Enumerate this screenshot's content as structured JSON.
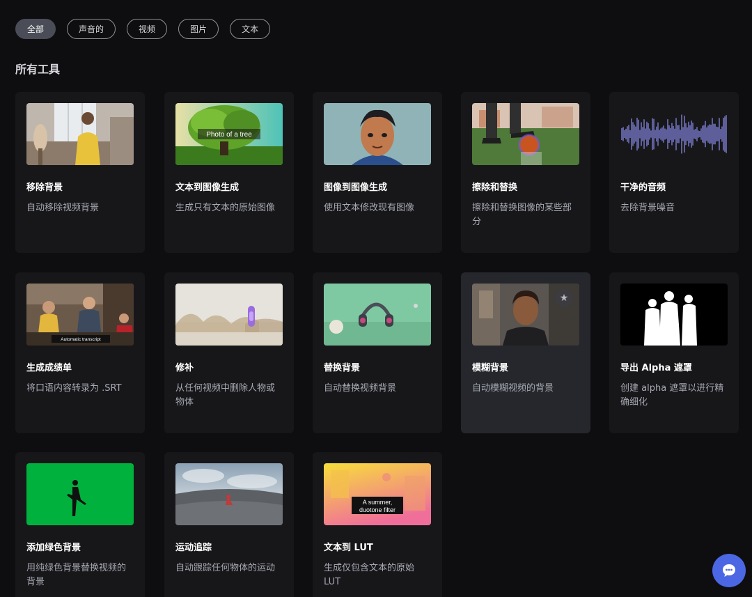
{
  "filters": [
    "全部",
    "声音的",
    "视频",
    "图片",
    "文本"
  ],
  "section_title": "所有工具",
  "cards": [
    {
      "title": "移除背景",
      "desc": "自动移除视频背景"
    },
    {
      "title": "文本到图像生成",
      "desc": "生成只有文本的原始图像",
      "overlay": "Photo of a tree"
    },
    {
      "title": "图像到图像生成",
      "desc": "使用文本修改现有图像"
    },
    {
      "title": "擦除和替换",
      "desc": "擦除和替换图像的某些部分"
    },
    {
      "title": "干净的音频",
      "desc": "去除背景噪音"
    },
    {
      "title": "生成成绩单",
      "desc": "将口语内容转录为 .SRT",
      "overlay": "Automatic transcript"
    },
    {
      "title": "修补",
      "desc": "从任何视频中删除人物或物体"
    },
    {
      "title": "替换背景",
      "desc": "自动替换视频背景"
    },
    {
      "title": "模糊背景",
      "desc": "自动模糊视频的背景"
    },
    {
      "title": "导出 Alpha 遮罩",
      "desc": "创建 alpha 遮罩以进行精确细化"
    },
    {
      "title": "添加绿色背景",
      "desc": "用纯绿色背景替换视频的背景"
    },
    {
      "title": "运动追踪",
      "desc": "自动跟踪任何物体的运动"
    },
    {
      "title": "文本到 LUT",
      "desc": "生成仅包含文本的原始LUT",
      "overlay_lines": [
        "A summer,",
        "duotone filter"
      ]
    }
  ],
  "icons": {
    "star": "star-icon",
    "chat": "chat-bubble-icon"
  },
  "colors": {
    "background": "#0e0e10",
    "card": "#17171a",
    "card_hover": "#25272d",
    "accent": "#4b67e4"
  }
}
